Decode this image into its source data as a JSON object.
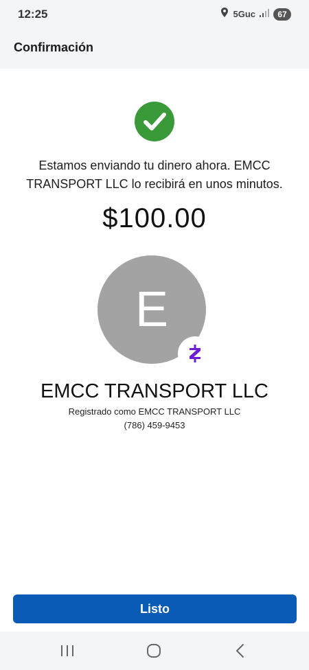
{
  "status_bar": {
    "time": "12:25",
    "network": "5Guc",
    "battery": "67"
  },
  "header": {
    "title": "Confirmación"
  },
  "confirmation": {
    "message": "Estamos enviando tu dinero ahora. EMCC TRANSPORT LLC lo recibirá en unos minutos.",
    "amount": "$100.00"
  },
  "recipient": {
    "initial": "E",
    "name": "EMCC TRANSPORT LLC",
    "registered_as": "Registrado como EMCC TRANSPORT LLC",
    "phone": "(786) 459-9453",
    "badge_icon": "zelle-logo-icon"
  },
  "actions": {
    "done_label": "Listo"
  },
  "colors": {
    "success": "#3a9a3a",
    "primary": "#0a5bb5",
    "zelle": "#6d1ed4",
    "avatar": "#a3a3a3"
  }
}
